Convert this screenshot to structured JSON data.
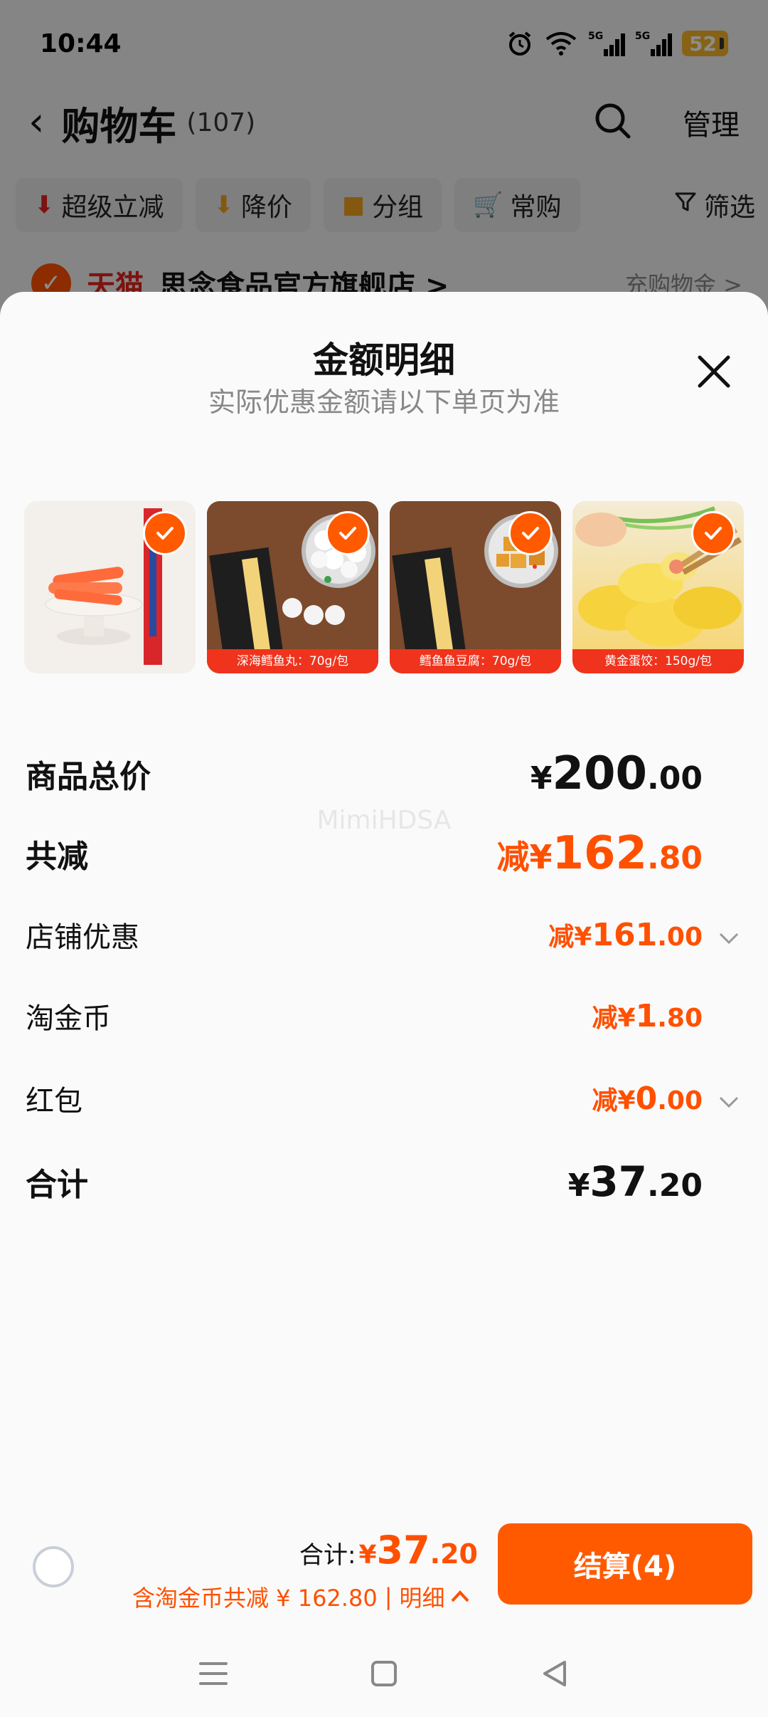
{
  "status_bar": {
    "time": "10:44",
    "signal1": "5G",
    "signal2": "5G",
    "battery": "52",
    "icons": [
      "alarm-icon",
      "wifi-icon",
      "signal-icon",
      "signal-icon",
      "battery-icon"
    ]
  },
  "nav": {
    "title": "购物车",
    "count": "(107)",
    "manage": "管理"
  },
  "filters": [
    {
      "label": "超级立减",
      "icon": "arrow-down-icon",
      "color": "#e2231a"
    },
    {
      "label": "降价",
      "icon": "price-drop-icon",
      "color": "#f0a020"
    },
    {
      "label": "分组",
      "icon": "folder-icon",
      "color": "#f0a020"
    },
    {
      "label": "常购",
      "icon": "cart-icon",
      "color": "#f0a020"
    },
    {
      "label": "筛选",
      "icon": "filter-icon",
      "color": "#333333"
    }
  ],
  "shop": {
    "tag": "天猫",
    "name": "思念食品官方旗舰店 >",
    "right": "充购物金 >"
  },
  "sheet": {
    "title": "金额明细",
    "subtitle": "实际优惠金额请以下单页为准",
    "products": [
      {
        "caption": ""
      },
      {
        "caption": "深海鳕鱼丸：70g/包"
      },
      {
        "caption": "鳕鱼鱼豆腐：70g/包"
      },
      {
        "caption": "黄金蛋饺：150g/包"
      }
    ],
    "watermark": "MimiHDSA",
    "rows": {
      "total_price": {
        "label": "商品总价",
        "currency": "¥",
        "int": "200",
        "dec": ".00"
      },
      "total_discount": {
        "label": "共减",
        "prefix": "减¥",
        "int": "162",
        "dec": ".80"
      },
      "shop_discount": {
        "label": "店铺优惠",
        "prefix": "减¥",
        "int": "161",
        "dec": ".00"
      },
      "taojinbi": {
        "label": "淘金币",
        "prefix": "减¥",
        "int": "1",
        "dec": ".80"
      },
      "red_packet": {
        "label": "红包",
        "prefix": "减¥",
        "int": "0",
        "dec": ".00"
      },
      "sum": {
        "label": "合计",
        "currency": "¥",
        "int": "37",
        "dec": ".20"
      }
    }
  },
  "bottom_bar": {
    "total_label": "合计:",
    "currency": "¥",
    "total_int": "37",
    "total_dec": ".20",
    "saving": "含淘金币共减 ¥ 162.80",
    "separator": "|",
    "detail": "明细",
    "checkout": "结算(4)"
  },
  "colors": {
    "accent": "#ff5000",
    "checkout_button": "#ff5a00"
  }
}
